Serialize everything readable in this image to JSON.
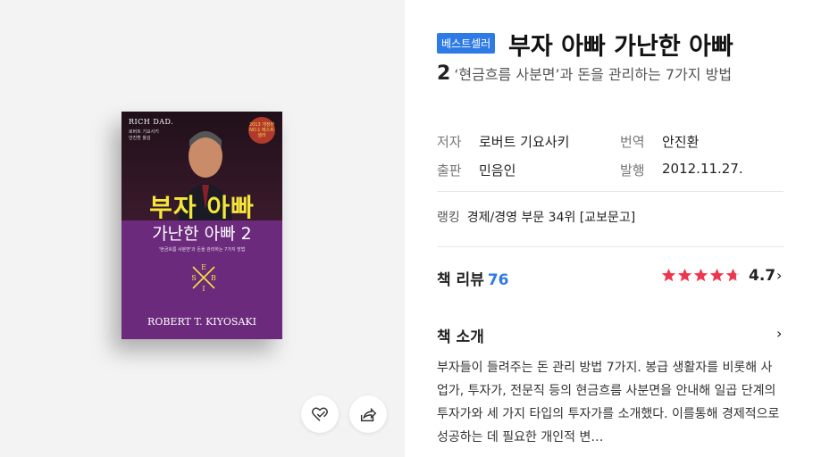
{
  "book": {
    "badge": "베스트셀러",
    "title": "부자 아빠 가난한 아빠",
    "volume": "2",
    "subtitle": "‘현금흐름 사분면’과 돈을 관리하는 7가지 방법"
  },
  "meta": {
    "author_label": "저자",
    "author": "로버트 기요사키",
    "translator_label": "번역",
    "translator": "안진환",
    "publisher_label": "출판",
    "publisher": "민음인",
    "date_label": "발행",
    "date": "2012.11.27."
  },
  "ranking": {
    "label": "랭킹",
    "value": "경제/경영 부문 34위 [교보문고]"
  },
  "reviews": {
    "label": "책 리뷰",
    "count": "76",
    "rating": "4.7",
    "rating_value": 4.7
  },
  "intro": {
    "title": "책 소개",
    "text": "부자들이 들려주는 돈 관리 방법 7가지. 봉급 생활자를 비롯해 사업가, 투자가, 전문직 등의 현금흐름 사분면을 안내해 일곱 단계의 투자가와 세 가지 타입의 투자가를 소개했다. 이를통해 경제적으로 성공하는 데 필요한 개인적 변…"
  },
  "cover": {
    "brand": "RICH DAD.",
    "title1": "부자 아빠",
    "title2": "가난한 아빠 2",
    "author": "ROBERT T. KIYOSAKI",
    "sub": "'현금흐름 사분면'과 돈을 관리하는 7가지 방법",
    "small_author": "로버트 기요사키",
    "small_translator": "안진환 옮김",
    "seal": "2013 개정판 NO.1 베스트셀러",
    "diamond": [
      "E",
      "B",
      "S",
      "I"
    ]
  },
  "icons": {
    "like": "heart-check-icon",
    "share": "share-icon",
    "chevron": "chevron-right-icon"
  },
  "colors": {
    "accent": "#2e7be5",
    "star": "#f0364f"
  }
}
